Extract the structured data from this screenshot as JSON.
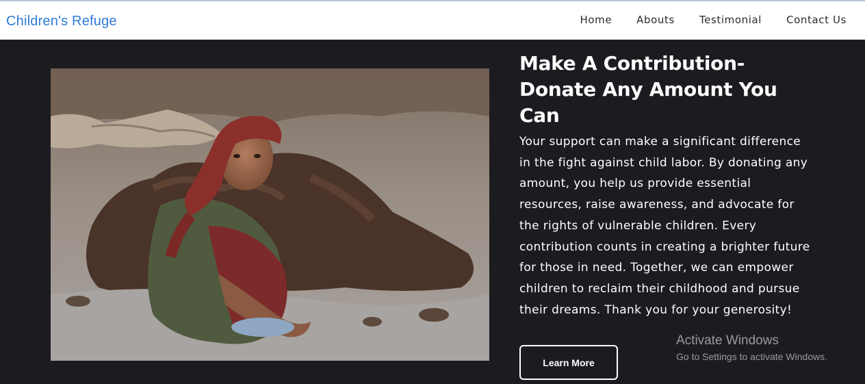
{
  "navbar": {
    "brand": "Children's Refuge",
    "links": [
      "Home",
      "Abouts",
      "Testimonial",
      "Contact Us"
    ]
  },
  "hero": {
    "image_alt": "Child crouching in mud at a brick kiln",
    "title_line1": "Make A Contribution-",
    "title_line2": "Donate Any Amount You Can",
    "body": "Your support can make a significant difference in the fight against child labor. By donating any amount, you help us provide essential resources, raise awareness, and advocate for the rights of vulnerable children. Every contribution counts in creating a brighter future for those in need. Together, we can empower children to reclaim their childhood and pursue their dreams. Thank you for your generosity!",
    "button_label": "Learn More"
  },
  "watermark": {
    "title": "Activate Windows",
    "subtitle": "Go to Settings to activate Windows."
  },
  "colors": {
    "background": "#1c1b20",
    "brand": "#2f7ad8",
    "navbar": "#ffffff",
    "text": "#ffffff"
  }
}
